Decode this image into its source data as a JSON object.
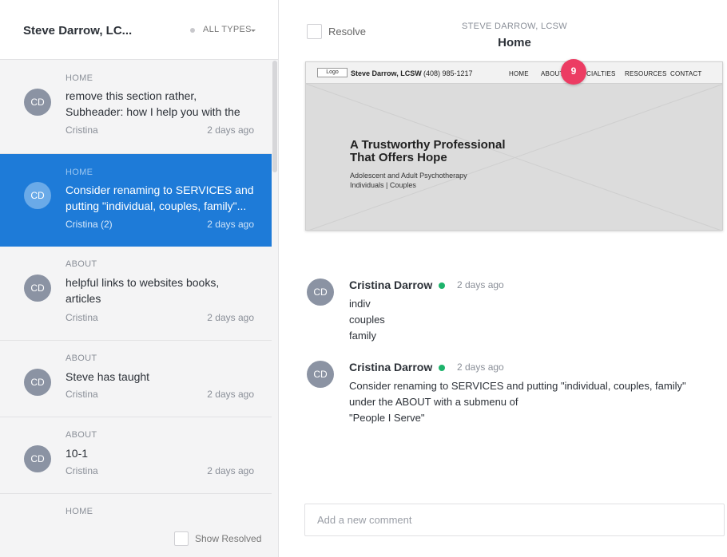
{
  "sidebar": {
    "title": "Steve Darrow, LC...",
    "type_filter": "ALL TYPES",
    "items": [
      {
        "page": "HOME",
        "text": "remove this section rather, Subheader: how I help you with the following...",
        "author": "Cristina",
        "time": "2 days ago",
        "avatar": "CD"
      },
      {
        "page": "HOME",
        "text": "Consider renaming to SERVICES and putting \"individual, couples, family\"...",
        "author": "Cristina (2)",
        "time": "2 days ago",
        "avatar": "CD"
      },
      {
        "page": "ABOUT",
        "text": "helpful links to websites books, articles",
        "author": "Cristina",
        "time": "2 days ago",
        "avatar": "CD"
      },
      {
        "page": "ABOUT",
        "text": "Steve has taught",
        "author": "Cristina",
        "time": "2 days ago",
        "avatar": "CD"
      },
      {
        "page": "ABOUT",
        "text": "10-1",
        "author": "Cristina",
        "time": "2 days ago",
        "avatar": "CD"
      },
      {
        "page": "HOME"
      }
    ],
    "show_resolved_label": "Show Resolved"
  },
  "detail": {
    "resolve_label": "Resolve",
    "site_name": "STEVE DARROW, LCSW",
    "page_name": "Home",
    "preview": {
      "logo": "Logo",
      "brand": "Steve Darrow, LCSW",
      "phone": "(408) 985-1217",
      "nav": [
        "HOME",
        "ABOUT",
        "CIALTIES",
        "RESOURCES",
        "CONTACT"
      ],
      "hero_title_1": "A Trustworthy Professional",
      "hero_title_2": "That Offers Hope",
      "hero_sub_1": "Adolescent and Adult Psychotherapy",
      "hero_sub_2": "Individuals | Couples",
      "pin_number": "9"
    },
    "comments": [
      {
        "avatar": "CD",
        "author": "Cristina Darrow",
        "time": "2 days ago",
        "lines": [
          "indiv",
          "couples",
          "family"
        ]
      },
      {
        "avatar": "CD",
        "author": "Cristina Darrow",
        "time": "2 days ago",
        "lines": [
          "Consider renaming to SERVICES and putting \"individual, couples, family\"",
          "under the ABOUT with a submenu of",
          "\"People I Serve\""
        ]
      }
    ],
    "new_comment_placeholder": "Add a new comment"
  }
}
